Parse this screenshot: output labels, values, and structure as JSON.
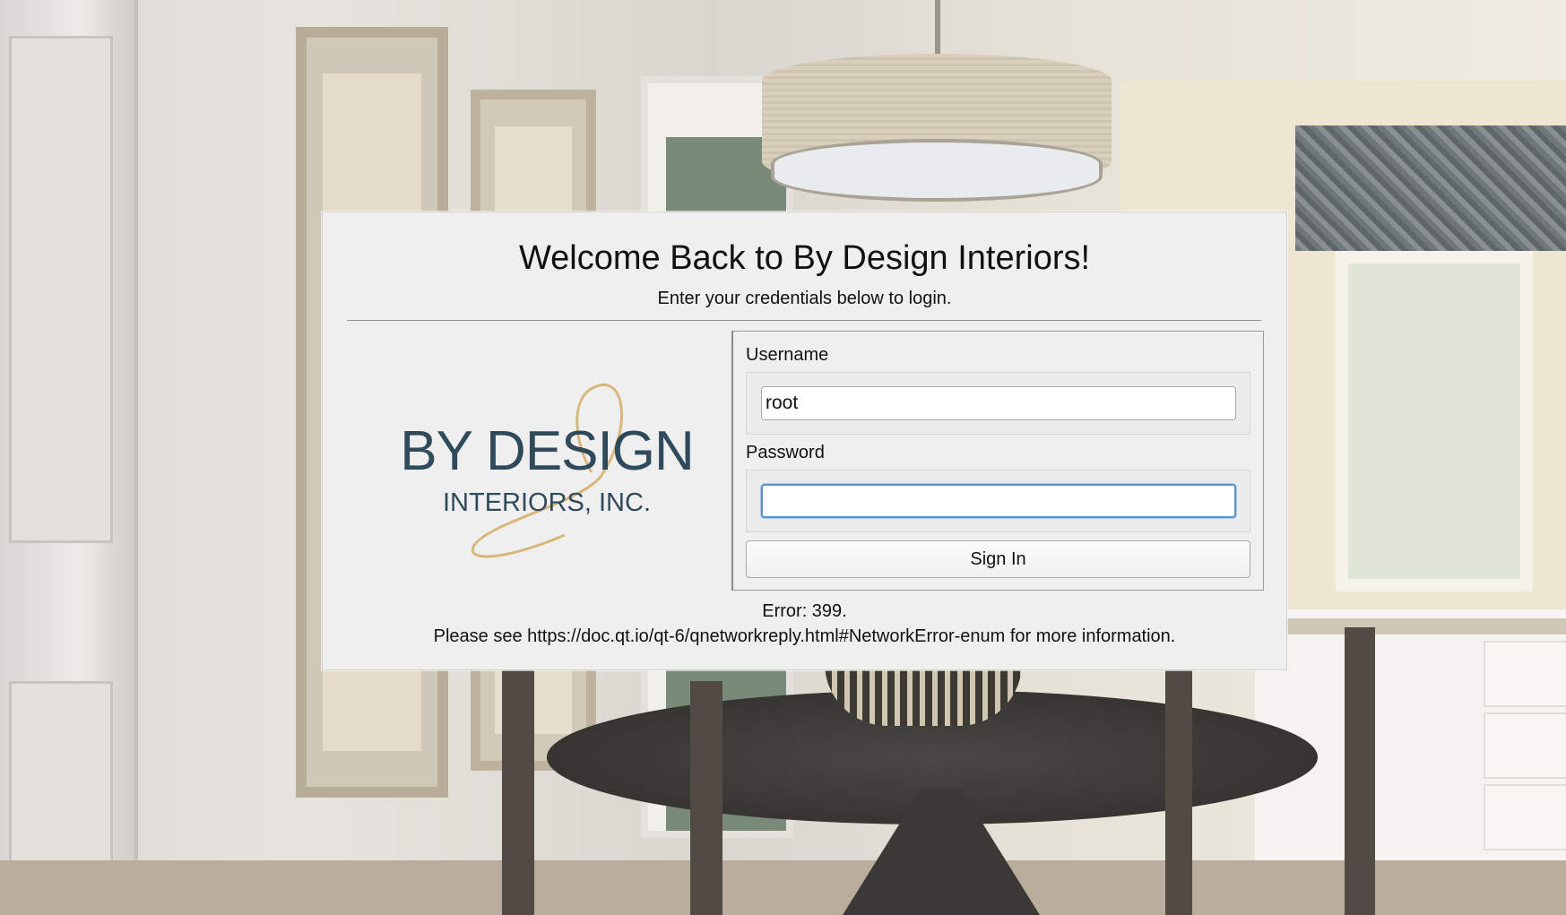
{
  "dialog": {
    "title": "Welcome Back to By Design Interiors!",
    "subtitle": "Enter your credentials below to login."
  },
  "logo": {
    "line1": "BY DESIGN",
    "line2": "INTERIORS, INC.",
    "text_color": "#2f4a5a",
    "swirl_color": "#d9b77a"
  },
  "form": {
    "username_label": "Username",
    "username_value": "root",
    "password_label": "Password",
    "password_value": "",
    "sign_in_label": "Sign In"
  },
  "error": {
    "line1": "Error: 399.",
    "line2": "Please see https://doc.qt.io/qt-6/qnetworkreply.html#NetworkError-enum for more information."
  },
  "colors": {
    "dialog_bg": "#efefef",
    "focus_ring": "#5b95c9"
  }
}
